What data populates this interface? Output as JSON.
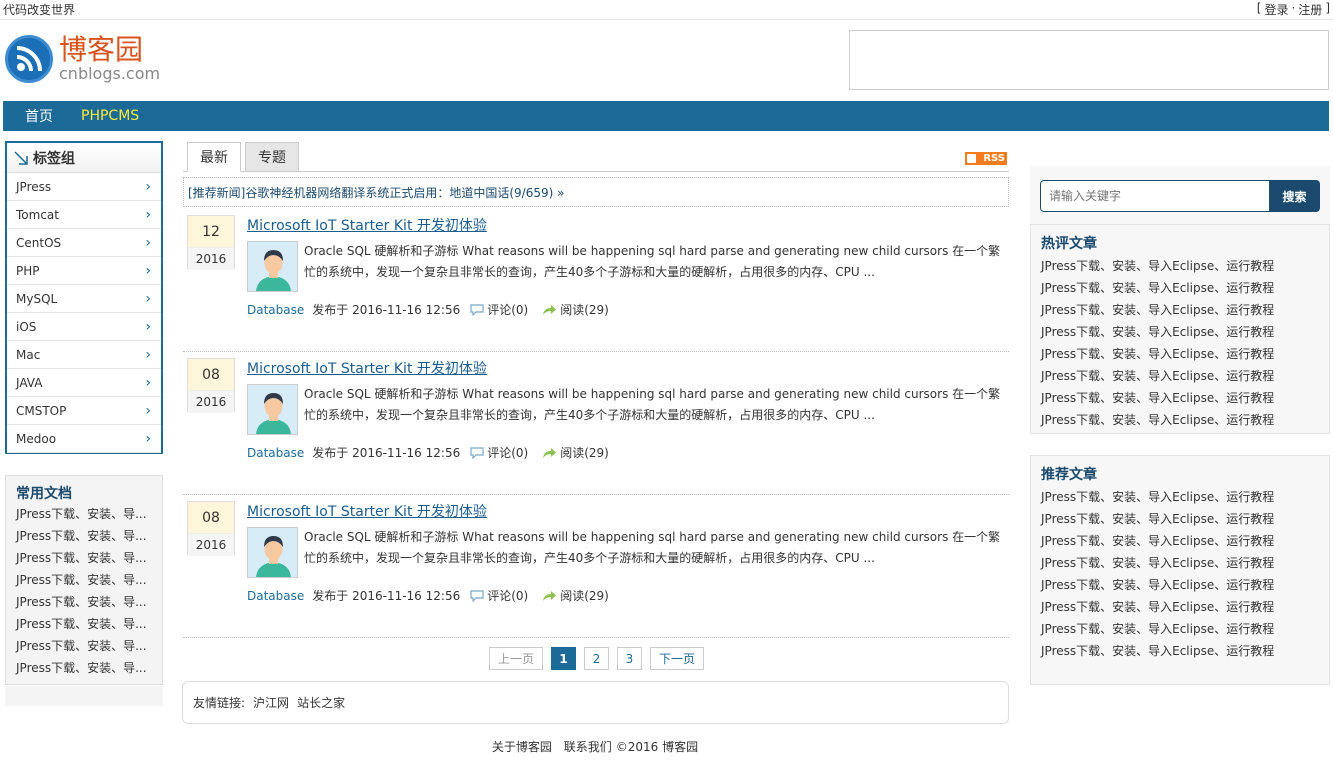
{
  "topbar": {
    "slogan": "代码改变世界",
    "login": "登录",
    "sep": "·",
    "register": "注册",
    "lb": "[",
    "rb": "]"
  },
  "logo": {
    "cn": "博客园",
    "en": "cnblogs.com"
  },
  "nav": {
    "home": "首页",
    "phpcms": "PHPCMS"
  },
  "tag_group": {
    "title": "标签组",
    "items": [
      "JPress",
      "Tomcat",
      "CentOS",
      "PHP",
      "MySQL",
      "iOS",
      "Mac",
      "JAVA",
      "CMSTOP",
      "Medoo"
    ]
  },
  "docs": {
    "title": "常用文档",
    "items": [
      "JPress下载、安装、导...",
      "JPress下载、安装、导...",
      "JPress下载、安装、导...",
      "JPress下载、安装、导...",
      "JPress下载、安装、导...",
      "JPress下载、安装、导...",
      "JPress下载、安装、导...",
      "JPress下载、安装、导..."
    ]
  },
  "tabs": {
    "latest": "最新",
    "topics": "专题",
    "rss": "RSS"
  },
  "news_banner": "[推荐新闻]谷歌神经机器网络翻译系统正式启用：地道中国话(9/659) »",
  "posts": [
    {
      "day": "12",
      "year": "2016",
      "title": "Microsoft IoT Starter Kit 开发初体验",
      "summary": "Oracle SQL 硬解析和子游标 What reasons will be happening sql hard parse and generating new child cursors 在一个繁忙的系统中，发现一个复杂且非常长的查询，产生40多个子游标和大量的硬解析，占用很多的内存、CPU ...",
      "category": "Database",
      "published": "发布于 2016-11-16 12:56",
      "comments": "评论(0)",
      "reads": "阅读(29)"
    },
    {
      "day": "08",
      "year": "2016",
      "title": "Microsoft IoT Starter Kit 开发初体验",
      "summary": "Oracle SQL 硬解析和子游标 What reasons will be happening sql hard parse and generating new child cursors 在一个繁忙的系统中，发现一个复杂且非常长的查询，产生40多个子游标和大量的硬解析，占用很多的内存、CPU ...",
      "category": "Database",
      "published": "发布于 2016-11-16 12:56",
      "comments": "评论(0)",
      "reads": "阅读(29)"
    },
    {
      "day": "08",
      "year": "2016",
      "title": "Microsoft IoT Starter Kit 开发初体验",
      "summary": "Oracle SQL 硬解析和子游标 What reasons will be happening sql hard parse and generating new child cursors 在一个繁忙的系统中，发现一个复杂且非常长的查询，产生40多个子游标和大量的硬解析，占用很多的内存、CPU ...",
      "category": "Database",
      "published": "发布于 2016-11-16 12:56",
      "comments": "评论(0)",
      "reads": "阅读(29)"
    }
  ],
  "pager": {
    "prev": "上一页",
    "pages": [
      "1",
      "2",
      "3"
    ],
    "current": "1",
    "next": "下一页"
  },
  "links": {
    "label": "友情链接:",
    "items": [
      "沪江网",
      "站长之家"
    ]
  },
  "footer": {
    "about": "关于博客园",
    "contact": "联系我们",
    "copyright": "©2016 博客园"
  },
  "search": {
    "placeholder": "请输入关键字",
    "button": "搜索"
  },
  "hot": {
    "title": "热评文章",
    "items": [
      "JPress下载、安装、导入Eclipse、运行教程",
      "JPress下载、安装、导入Eclipse、运行教程",
      "JPress下载、安装、导入Eclipse、运行教程",
      "JPress下载、安装、导入Eclipse、运行教程",
      "JPress下载、安装、导入Eclipse、运行教程",
      "JPress下载、安装、导入Eclipse、运行教程",
      "JPress下载、安装、导入Eclipse、运行教程",
      "JPress下载、安装、导入Eclipse、运行教程"
    ]
  },
  "recommended": {
    "title": "推荐文章",
    "items": [
      "JPress下载、安装、导入Eclipse、运行教程",
      "JPress下载、安装、导入Eclipse、运行教程",
      "JPress下载、安装、导入Eclipse、运行教程",
      "JPress下载、安装、导入Eclipse、运行教程",
      "JPress下载、安装、导入Eclipse、运行教程",
      "JPress下载、安装、导入Eclipse、运行教程",
      "JPress下载、安装、导入Eclipse、运行教程",
      "JPress下载、安装、导入Eclipse、运行教程"
    ]
  },
  "colors": {
    "nav": "#1b6a97",
    "accent": "#1b4a6e",
    "phpcms": "#ffea3b",
    "logo": "#d9531e"
  }
}
